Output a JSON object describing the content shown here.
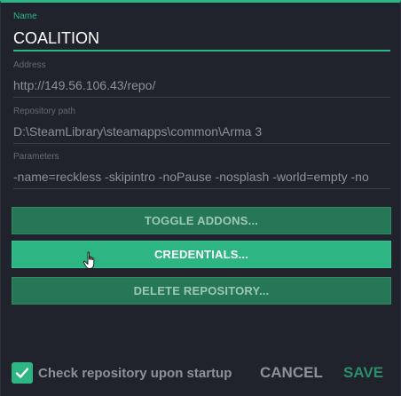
{
  "fields": {
    "name": {
      "label": "Name",
      "value": "COALITION"
    },
    "address": {
      "label": "Address",
      "value": "http://149.56.106.43/repo/"
    },
    "path": {
      "label": "Repository path",
      "value": "D:\\SteamLibrary\\steamapps\\common\\Arma 3"
    },
    "params": {
      "label": "Parameters",
      "value": "-name=reckless -skipintro -noPause -nosplash -world=empty -no"
    }
  },
  "buttons": {
    "toggle": "TOGGLE ADDONS...",
    "credentials": "CREDENTIALS...",
    "delete": "DELETE REPOSITORY..."
  },
  "startup_check": {
    "label": "Check repository upon startup",
    "checked": true
  },
  "actions": {
    "cancel": "CANCEL",
    "save": "SAVE"
  },
  "colors": {
    "accent": "#2db584",
    "background": "#20232c",
    "button_dark": "#267756"
  }
}
